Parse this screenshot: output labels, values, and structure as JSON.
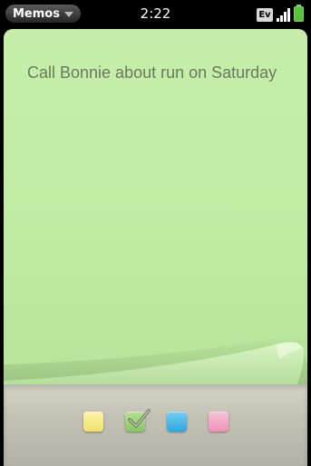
{
  "status_bar": {
    "app_menu_label": "Memos",
    "time": "2:22",
    "network_label": "Ev"
  },
  "memo": {
    "text": "Call Bonnie about run on Saturday",
    "color": "#c3eca6"
  },
  "color_picker": {
    "swatches": [
      {
        "name": "yellow",
        "color": "#f7ee8a",
        "selected": false
      },
      {
        "name": "green",
        "color": "#9fd27a",
        "selected": true
      },
      {
        "name": "blue",
        "color": "#4ab8ec",
        "selected": false
      },
      {
        "name": "pink",
        "color": "#f4a9c8",
        "selected": false
      }
    ]
  },
  "icons": {
    "app_menu_caret": "chevron-down-icon",
    "network": "ev-network-icon",
    "signal": "signal-strength-icon",
    "battery": "battery-icon",
    "selected_check": "checkmark-icon"
  }
}
